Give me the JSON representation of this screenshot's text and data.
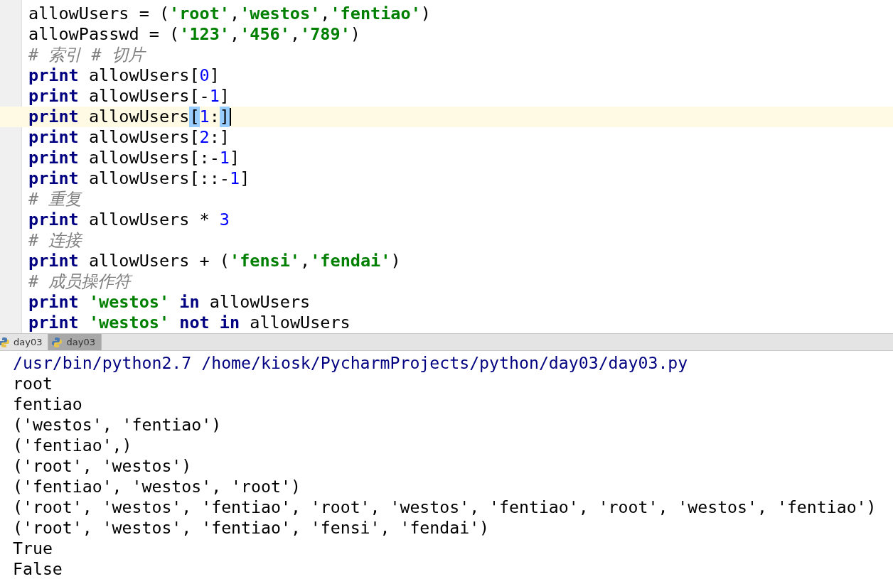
{
  "editor": {
    "lines": [
      {
        "current": false,
        "tokens": [
          {
            "kind": "plain",
            "text": "allowUsers = ("
          },
          {
            "kind": "str",
            "text": "'root'"
          },
          {
            "kind": "plain",
            "text": ","
          },
          {
            "kind": "str",
            "text": "'westos'"
          },
          {
            "kind": "plain",
            "text": ","
          },
          {
            "kind": "str",
            "text": "'fentiao'"
          },
          {
            "kind": "plain",
            "text": ")"
          }
        ]
      },
      {
        "current": false,
        "tokens": [
          {
            "kind": "plain",
            "text": "allowPasswd = ("
          },
          {
            "kind": "str",
            "text": "'123'"
          },
          {
            "kind": "plain",
            "text": ","
          },
          {
            "kind": "str",
            "text": "'456'"
          },
          {
            "kind": "plain",
            "text": ","
          },
          {
            "kind": "str",
            "text": "'789'"
          },
          {
            "kind": "plain",
            "text": ")"
          }
        ]
      },
      {
        "current": false,
        "tokens": [
          {
            "kind": "comment",
            "text": "# 索引 # 切片"
          }
        ]
      },
      {
        "current": false,
        "tokens": [
          {
            "kind": "kw",
            "text": "print"
          },
          {
            "kind": "plain",
            "text": " allowUsers["
          },
          {
            "kind": "num",
            "text": "0"
          },
          {
            "kind": "plain",
            "text": "]"
          }
        ]
      },
      {
        "current": false,
        "tokens": [
          {
            "kind": "kw",
            "text": "print"
          },
          {
            "kind": "plain",
            "text": " allowUsers[-"
          },
          {
            "kind": "num",
            "text": "1"
          },
          {
            "kind": "plain",
            "text": "]"
          }
        ]
      },
      {
        "current": true,
        "tokens": [
          {
            "kind": "kw",
            "text": "print"
          },
          {
            "kind": "plain",
            "text": " allowUsers"
          },
          {
            "kind": "match",
            "text": "["
          },
          {
            "kind": "num",
            "text": "1"
          },
          {
            "kind": "plain",
            "text": ":"
          },
          {
            "kind": "match",
            "text": "]"
          }
        ]
      },
      {
        "current": false,
        "tokens": [
          {
            "kind": "kw",
            "text": "print"
          },
          {
            "kind": "plain",
            "text": " allowUsers["
          },
          {
            "kind": "num",
            "text": "2"
          },
          {
            "kind": "plain",
            "text": ":]"
          }
        ]
      },
      {
        "current": false,
        "tokens": [
          {
            "kind": "kw",
            "text": "print"
          },
          {
            "kind": "plain",
            "text": " allowUsers[:-"
          },
          {
            "kind": "num",
            "text": "1"
          },
          {
            "kind": "plain",
            "text": "]"
          }
        ]
      },
      {
        "current": false,
        "tokens": [
          {
            "kind": "kw",
            "text": "print"
          },
          {
            "kind": "plain",
            "text": " allowUsers[::-"
          },
          {
            "kind": "num",
            "text": "1"
          },
          {
            "kind": "plain",
            "text": "]"
          }
        ]
      },
      {
        "current": false,
        "tokens": [
          {
            "kind": "comment",
            "text": "# 重复"
          }
        ]
      },
      {
        "current": false,
        "tokens": [
          {
            "kind": "kw",
            "text": "print"
          },
          {
            "kind": "plain",
            "text": " allowUsers * "
          },
          {
            "kind": "num",
            "text": "3"
          }
        ]
      },
      {
        "current": false,
        "tokens": [
          {
            "kind": "comment",
            "text": "# 连接"
          }
        ]
      },
      {
        "current": false,
        "tokens": [
          {
            "kind": "kw",
            "text": "print"
          },
          {
            "kind": "plain",
            "text": " allowUsers + ("
          },
          {
            "kind": "str",
            "text": "'fensi'"
          },
          {
            "kind": "plain",
            "text": ","
          },
          {
            "kind": "str",
            "text": "'fendai'"
          },
          {
            "kind": "plain",
            "text": ")"
          }
        ]
      },
      {
        "current": false,
        "tokens": [
          {
            "kind": "comment",
            "text": "# 成员操作符"
          }
        ]
      },
      {
        "current": false,
        "tokens": [
          {
            "kind": "kw",
            "text": "print"
          },
          {
            "kind": "str",
            "text": " 'westos'"
          },
          {
            "kind": "kw",
            "text": " in"
          },
          {
            "kind": "plain",
            "text": " allowUsers"
          }
        ]
      },
      {
        "current": false,
        "tokens": [
          {
            "kind": "kw",
            "text": "print"
          },
          {
            "kind": "str",
            "text": " 'westos'"
          },
          {
            "kind": "kw",
            "text": " not in"
          },
          {
            "kind": "plain",
            "text": " allowUsers"
          }
        ]
      }
    ]
  },
  "run_tabs": [
    {
      "label": "day03",
      "selected": false
    },
    {
      "label": "day03",
      "selected": true
    }
  ],
  "console": {
    "lines": [
      {
        "kind": "command",
        "text": "/usr/bin/python2.7 /home/kiosk/PycharmProjects/python/day03/day03.py"
      },
      {
        "kind": "output",
        "text": "root"
      },
      {
        "kind": "output",
        "text": "fentiao"
      },
      {
        "kind": "output",
        "text": "('westos', 'fentiao')"
      },
      {
        "kind": "output",
        "text": "('fentiao',)"
      },
      {
        "kind": "output",
        "text": "('root', 'westos')"
      },
      {
        "kind": "output",
        "text": "('fentiao', 'westos', 'root')"
      },
      {
        "kind": "output",
        "text": "('root', 'westos', 'fentiao', 'root', 'westos', 'fentiao', 'root', 'westos', 'fentiao')"
      },
      {
        "kind": "output",
        "text": "('root', 'westos', 'fentiao', 'fensi', 'fendai')"
      },
      {
        "kind": "output",
        "text": "True"
      },
      {
        "kind": "output",
        "text": "False"
      }
    ]
  }
}
